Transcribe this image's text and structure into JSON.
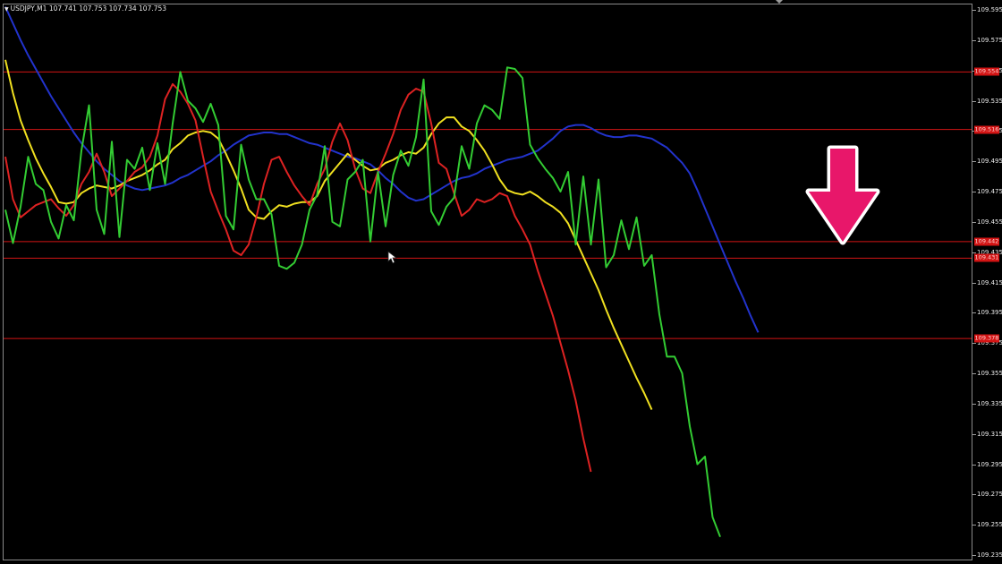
{
  "header": {
    "symbol": "USDJPY,M1",
    "ohlc": "107.741 107.753 107.734 107.753"
  },
  "price_scale": {
    "labels": [
      "109.595",
      "109.575",
      "109.555",
      "109.535",
      "109.515",
      "109.495",
      "109.475",
      "109.455",
      "109.435",
      "109.415",
      "109.395",
      "109.375",
      "109.355",
      "109.335",
      "109.315",
      "109.295",
      "109.275",
      "109.255",
      "109.235"
    ]
  },
  "chart_data": {
    "type": "line",
    "y_range": [
      109.235,
      109.595
    ],
    "x": [
      0,
      1,
      2,
      3,
      4,
      5,
      6,
      7,
      8,
      9,
      10,
      11,
      12,
      13,
      14,
      15,
      16,
      17,
      18,
      19,
      20,
      21,
      22,
      23,
      24,
      25,
      26,
      27,
      28,
      29,
      30,
      31,
      32,
      33,
      34,
      35,
      36,
      37,
      38,
      39,
      40,
      41,
      42,
      43,
      44,
      45,
      46,
      47,
      48,
      49,
      50,
      51,
      52,
      53,
      54,
      55,
      56,
      57,
      58,
      59,
      60,
      61,
      62,
      63,
      64,
      65,
      66,
      67,
      68,
      69,
      70,
      71,
      72,
      73,
      74,
      75,
      76,
      77,
      78,
      79,
      80,
      81,
      82,
      83,
      84,
      85,
      86,
      87,
      88,
      89,
      90,
      91,
      92,
      93,
      94,
      95,
      96,
      97,
      98,
      99,
      100,
      101,
      102,
      103,
      104,
      105,
      106,
      107,
      108,
      109,
      110,
      111,
      112,
      113,
      114,
      115,
      116,
      117,
      118,
      119,
      120,
      121,
      122,
      123,
      124,
      125,
      126,
      127,
      128
    ],
    "horizontal_levels": [
      {
        "value": 109.554,
        "label": "109.554",
        "color": "#d21414"
      },
      {
        "value": 109.516,
        "label": "109.516",
        "color": "#d21414"
      },
      {
        "value": 109.442,
        "label": "109.442",
        "color": "#d21414"
      },
      {
        "value": 109.431,
        "label": "109.431",
        "color": "#d21414"
      },
      {
        "value": 109.378,
        "label": "109.378",
        "color": "#d21414"
      }
    ],
    "series": [
      {
        "color": "#2233cc",
        "values": [
          109.597,
          109.586,
          109.575,
          109.565,
          109.556,
          109.547,
          109.538,
          109.53,
          109.522,
          109.514,
          109.507,
          109.501,
          109.495,
          109.49,
          109.486,
          109.482,
          109.479,
          109.477,
          109.476,
          109.477,
          109.478,
          109.479,
          109.481,
          109.484,
          109.486,
          109.489,
          109.492,
          109.495,
          109.499,
          109.502,
          109.506,
          109.509,
          109.512,
          109.513,
          109.514,
          109.514,
          109.513,
          109.513,
          109.511,
          109.509,
          109.507,
          109.506,
          109.504,
          109.502,
          109.5,
          109.498,
          109.497,
          109.495,
          109.493,
          109.489,
          109.484,
          109.48,
          109.475,
          109.471,
          109.469,
          109.47,
          109.473,
          109.476,
          109.479,
          109.482,
          109.484,
          109.485,
          109.487,
          109.49,
          109.492,
          109.494,
          109.496,
          109.497,
          109.498,
          109.5,
          109.502,
          109.506,
          109.51,
          109.515,
          109.518,
          109.519,
          109.519,
          109.517,
          109.514,
          109.512,
          109.511,
          109.511,
          109.512,
          109.512,
          109.511,
          109.51,
          109.507,
          109.504,
          109.499,
          109.494,
          109.487,
          109.476,
          109.464,
          109.452,
          109.44,
          109.428,
          109.416,
          109.405,
          109.393,
          109.382
        ]
      },
      {
        "color": "#f0e020",
        "values": [
          109.562,
          109.54,
          109.522,
          109.509,
          109.497,
          109.487,
          109.478,
          109.468,
          109.467,
          109.468,
          109.474,
          109.477,
          109.479,
          109.478,
          109.477,
          109.479,
          109.482,
          109.484,
          109.486,
          109.489,
          109.493,
          109.496,
          109.503,
          109.507,
          109.512,
          109.514,
          109.515,
          109.514,
          109.51,
          109.5,
          109.489,
          109.477,
          109.463,
          109.458,
          109.457,
          109.462,
          109.466,
          109.465,
          109.467,
          109.468,
          109.468,
          109.472,
          109.482,
          109.488,
          109.494,
          109.5,
          109.496,
          109.492,
          109.489,
          109.49,
          109.494,
          109.496,
          109.499,
          109.501,
          109.5,
          109.504,
          109.513,
          109.52,
          109.524,
          109.524,
          109.518,
          109.515,
          109.509,
          109.502,
          109.493,
          109.483,
          109.476,
          109.474,
          109.473,
          109.475,
          109.472,
          109.468,
          109.465,
          109.461,
          109.454,
          109.443,
          109.432,
          109.421,
          109.41,
          109.397,
          109.385,
          109.374,
          109.363,
          109.352,
          109.342,
          109.331
        ]
      },
      {
        "color": "#dd2222",
        "values": [
          109.498,
          109.47,
          109.458,
          109.462,
          109.466,
          109.468,
          109.47,
          109.464,
          109.459,
          109.466,
          109.48,
          109.488,
          109.5,
          109.488,
          109.472,
          109.477,
          109.482,
          109.488,
          109.491,
          109.498,
          109.512,
          109.536,
          109.546,
          109.541,
          109.533,
          109.522,
          109.498,
          109.475,
          109.462,
          109.45,
          109.436,
          109.433,
          109.44,
          109.458,
          109.48,
          109.496,
          109.498,
          109.488,
          109.479,
          109.472,
          109.466,
          109.48,
          109.49,
          109.508,
          109.52,
          109.509,
          109.49,
          109.477,
          109.474,
          109.488,
          109.5,
          109.513,
          109.529,
          109.539,
          109.543,
          109.541,
          109.52,
          109.494,
          109.49,
          109.474,
          109.459,
          109.463,
          109.47,
          109.468,
          109.47,
          109.474,
          109.472,
          109.459,
          109.45,
          109.44,
          109.423,
          109.408,
          109.393,
          109.375,
          109.357,
          109.337,
          109.312,
          109.29
        ]
      },
      {
        "color": "#33cc33",
        "values": [
          109.463,
          109.441,
          109.465,
          109.498,
          109.48,
          109.476,
          109.455,
          109.444,
          109.466,
          109.456,
          109.502,
          109.532,
          109.463,
          109.447,
          109.508,
          109.445,
          109.496,
          109.49,
          109.504,
          109.476,
          109.507,
          109.48,
          109.52,
          109.554,
          109.535,
          109.53,
          109.521,
          109.533,
          109.519,
          109.459,
          109.45,
          109.506,
          109.483,
          109.47,
          109.47,
          109.46,
          109.426,
          109.424,
          109.428,
          109.44,
          109.463,
          109.473,
          109.505,
          109.455,
          109.452,
          109.483,
          109.488,
          109.496,
          109.442,
          109.488,
          109.452,
          109.486,
          109.502,
          109.492,
          109.511,
          109.549,
          109.462,
          109.453,
          109.465,
          109.471,
          109.505,
          109.49,
          109.52,
          109.532,
          109.529,
          109.523,
          109.557,
          109.556,
          109.55,
          109.506,
          109.497,
          109.49,
          109.484,
          109.475,
          109.488,
          109.44,
          109.485,
          109.44,
          109.483,
          109.425,
          109.433,
          109.456,
          109.437,
          109.458,
          109.426,
          109.433,
          109.394,
          109.366,
          109.366,
          109.355,
          109.32,
          109.295,
          109.3,
          109.26,
          109.247
        ]
      }
    ]
  },
  "annotation": {
    "arrow_color": "#e8176a",
    "arrow_outline": "#ffffff"
  }
}
